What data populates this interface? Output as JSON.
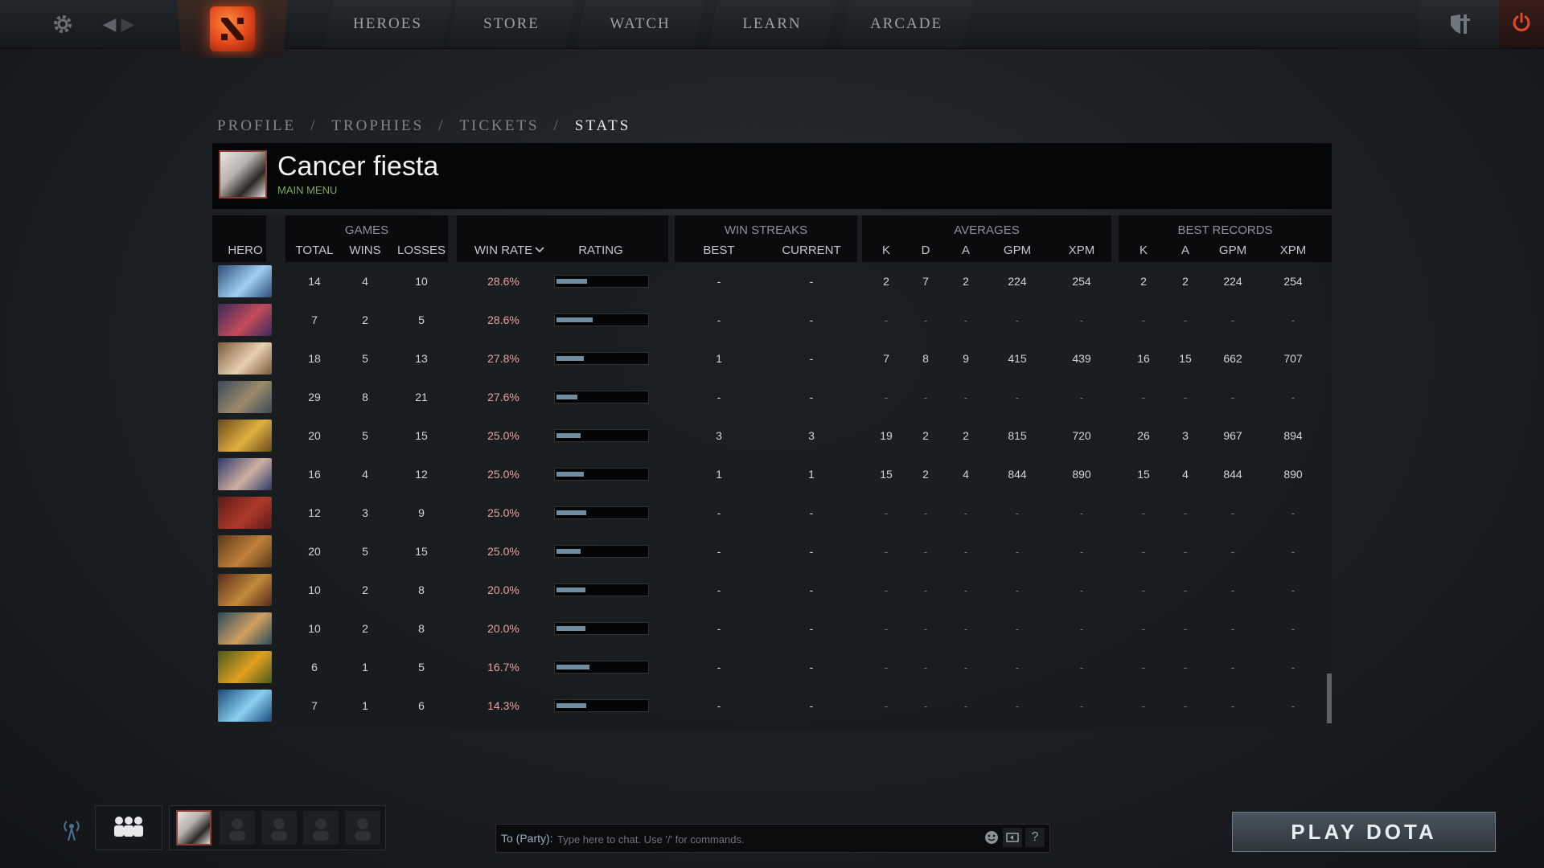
{
  "nav": {
    "items": [
      {
        "label": "HEROES"
      },
      {
        "label": "STORE"
      },
      {
        "label": "WATCH"
      },
      {
        "label": "LEARN"
      },
      {
        "label": "ARCADE"
      }
    ],
    "icons": [
      "gear-icon",
      "back-arrow-icon",
      "forward-arrow-icon",
      "dota-logo-icon",
      "shield-sword-icon",
      "power-icon"
    ]
  },
  "breadcrumb": {
    "items": [
      "PROFILE",
      "TROPHIES",
      "TICKETS",
      "STATS"
    ],
    "separator": "/",
    "active_index": 3
  },
  "profile": {
    "name": "Cancer fiesta",
    "status": "MAIN MENU"
  },
  "table": {
    "groups": {
      "games": "GAMES",
      "streaks": "WIN STREAKS",
      "averages": "AVERAGES",
      "best": "BEST RECORDS"
    },
    "headers": {
      "hero": "HERO",
      "total": "TOTAL",
      "wins": "WINS",
      "losses": "LOSSES",
      "win_rate": "WIN RATE",
      "rating": "RATING",
      "best": "BEST",
      "current": "CURRENT",
      "avg_k": "K",
      "avg_d": "D",
      "avg_a": "A",
      "avg_gpm": "GPM",
      "avg_xpm": "XPM",
      "best_k": "K",
      "best_a": "A",
      "best_gpm": "GPM",
      "best_xpm": "XPM"
    },
    "sort_icon": "chevron-down-icon",
    "rows": [
      {
        "hero_colors": [
          "#2c4c7a",
          "#9fd0f0"
        ],
        "total": "14",
        "wins": "4",
        "losses": "10",
        "win_rate": "28.6%",
        "rating": 0.34,
        "best": "-",
        "current": "-",
        "avg_k": "2",
        "avg_d": "7",
        "avg_a": "2",
        "avg_gpm": "224",
        "avg_xpm": "254",
        "best_k": "2",
        "best_a": "2",
        "best_gpm": "224",
        "best_xpm": "254"
      },
      {
        "hero_colors": [
          "#3a2a5a",
          "#c34a5a"
        ],
        "total": "7",
        "wins": "2",
        "losses": "5",
        "win_rate": "28.6%",
        "rating": 0.4,
        "best": "-",
        "current": "-",
        "avg_k": "-",
        "avg_d": "-",
        "avg_a": "-",
        "avg_gpm": "-",
        "avg_xpm": "-",
        "best_k": "-",
        "best_a": "-",
        "best_gpm": "-",
        "best_xpm": "-"
      },
      {
        "hero_colors": [
          "#7a5a3a",
          "#e8d0b0"
        ],
        "total": "18",
        "wins": "5",
        "losses": "13",
        "win_rate": "27.8%",
        "rating": 0.3,
        "best": "1",
        "current": "-",
        "avg_k": "7",
        "avg_d": "8",
        "avg_a": "9",
        "avg_gpm": "415",
        "avg_xpm": "439",
        "best_k": "16",
        "best_a": "15",
        "best_gpm": "662",
        "best_xpm": "707"
      },
      {
        "hero_colors": [
          "#3a4a5a",
          "#9c8a6a"
        ],
        "total": "29",
        "wins": "8",
        "losses": "21",
        "win_rate": "27.6%",
        "rating": 0.23,
        "best": "-",
        "current": "-",
        "avg_k": "-",
        "avg_d": "-",
        "avg_a": "-",
        "avg_gpm": "-",
        "avg_xpm": "-",
        "best_k": "-",
        "best_a": "-",
        "best_gpm": "-",
        "best_xpm": "-"
      },
      {
        "hero_colors": [
          "#6a4a1a",
          "#e0b040"
        ],
        "total": "20",
        "wins": "5",
        "losses": "15",
        "win_rate": "25.0%",
        "rating": 0.27,
        "best": "3",
        "current": "3",
        "avg_k": "19",
        "avg_d": "2",
        "avg_a": "2",
        "avg_gpm": "815",
        "avg_xpm": "720",
        "best_k": "26",
        "best_a": "3",
        "best_gpm": "967",
        "best_xpm": "894"
      },
      {
        "hero_colors": [
          "#2a3a6a",
          "#d0b0a0"
        ],
        "total": "16",
        "wins": "4",
        "losses": "12",
        "win_rate": "25.0%",
        "rating": 0.3,
        "best": "1",
        "current": "1",
        "avg_k": "15",
        "avg_d": "2",
        "avg_a": "4",
        "avg_gpm": "844",
        "avg_xpm": "890",
        "best_k": "15",
        "best_a": "4",
        "best_gpm": "844",
        "best_xpm": "890"
      },
      {
        "hero_colors": [
          "#5a1a1a",
          "#b03a2a"
        ],
        "total": "12",
        "wins": "3",
        "losses": "9",
        "win_rate": "25.0%",
        "rating": 0.33,
        "best": "-",
        "current": "-",
        "avg_k": "-",
        "avg_d": "-",
        "avg_a": "-",
        "avg_gpm": "-",
        "avg_xpm": "-",
        "best_k": "-",
        "best_a": "-",
        "best_gpm": "-",
        "best_xpm": "-"
      },
      {
        "hero_colors": [
          "#5a3a1a",
          "#c0803a"
        ],
        "total": "20",
        "wins": "5",
        "losses": "15",
        "win_rate": "25.0%",
        "rating": 0.27,
        "best": "-",
        "current": "-",
        "avg_k": "-",
        "avg_d": "-",
        "avg_a": "-",
        "avg_gpm": "-",
        "avg_xpm": "-",
        "best_k": "-",
        "best_a": "-",
        "best_gpm": "-",
        "best_xpm": "-"
      },
      {
        "hero_colors": [
          "#5a2a1a",
          "#c08a3a"
        ],
        "total": "10",
        "wins": "2",
        "losses": "8",
        "win_rate": "20.0%",
        "rating": 0.32,
        "best": "-",
        "current": "-",
        "avg_k": "-",
        "avg_d": "-",
        "avg_a": "-",
        "avg_gpm": "-",
        "avg_xpm": "-",
        "best_k": "-",
        "best_a": "-",
        "best_gpm": "-",
        "best_xpm": "-"
      },
      {
        "hero_colors": [
          "#2a4a5a",
          "#d0a060"
        ],
        "total": "10",
        "wins": "2",
        "losses": "8",
        "win_rate": "20.0%",
        "rating": 0.32,
        "best": "-",
        "current": "-",
        "avg_k": "-",
        "avg_d": "-",
        "avg_a": "-",
        "avg_gpm": "-",
        "avg_xpm": "-",
        "best_k": "-",
        "best_a": "-",
        "best_gpm": "-",
        "best_xpm": "-"
      },
      {
        "hero_colors": [
          "#4a5a1a",
          "#e0a020"
        ],
        "total": "6",
        "wins": "1",
        "losses": "5",
        "win_rate": "16.7%",
        "rating": 0.37,
        "best": "-",
        "current": "-",
        "avg_k": "-",
        "avg_d": "-",
        "avg_a": "-",
        "avg_gpm": "-",
        "avg_xpm": "-",
        "best_k": "-",
        "best_a": "-",
        "best_gpm": "-",
        "best_xpm": "-"
      },
      {
        "hero_colors": [
          "#1a4a7a",
          "#8ad0f0"
        ],
        "total": "7",
        "wins": "1",
        "losses": "6",
        "win_rate": "14.3%",
        "rating": 0.33,
        "best": "-",
        "current": "-",
        "avg_k": "-",
        "avg_d": "-",
        "avg_a": "-",
        "avg_gpm": "-",
        "avg_xpm": "-",
        "best_k": "-",
        "best_a": "-",
        "best_gpm": "-",
        "best_xpm": "-"
      }
    ]
  },
  "chat": {
    "label": "To (Party):",
    "placeholder": "Type here to chat. Use '/' for commands.",
    "help": "?"
  },
  "play_button": "PLAY DOTA",
  "colors": {
    "accent_red": "#c4431b",
    "status_green": "#7fa85a",
    "win_rate": "#e8a0a0",
    "rating_fill": "#6f8ea1"
  }
}
